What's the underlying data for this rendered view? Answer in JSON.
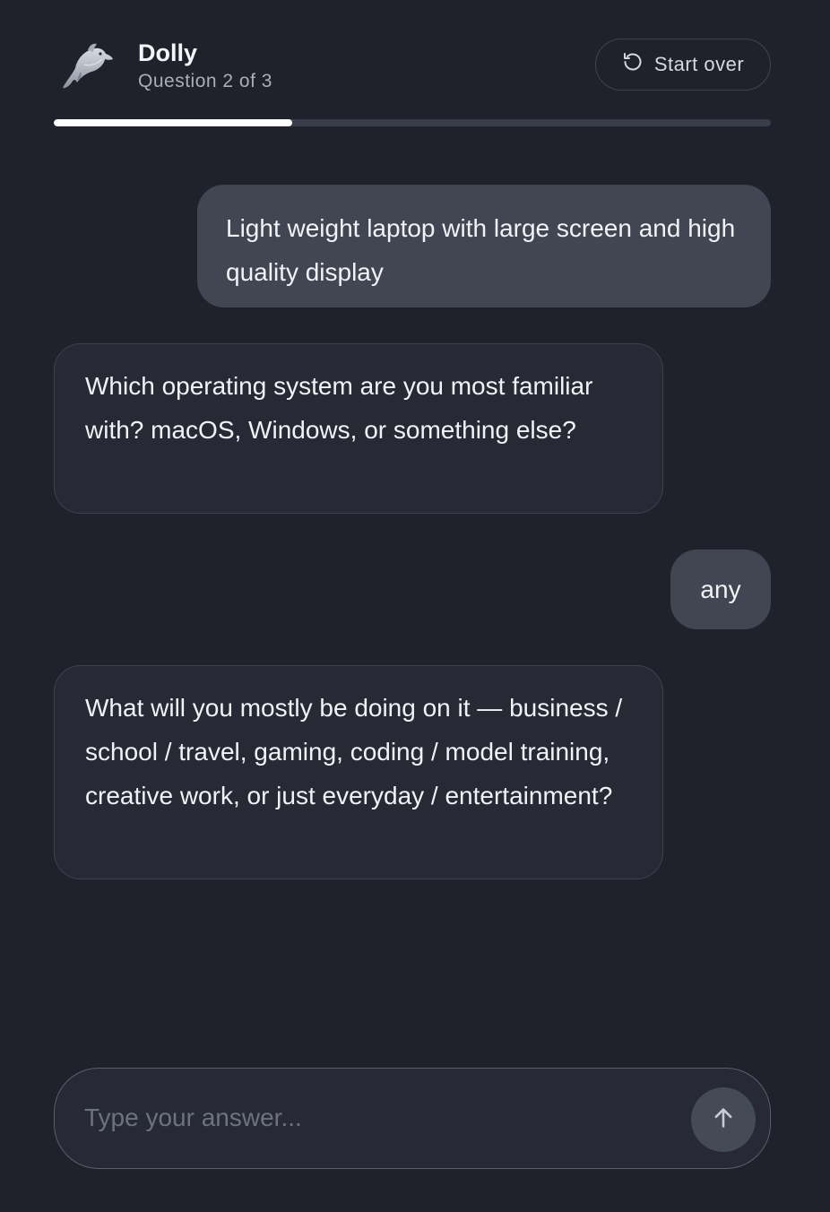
{
  "header": {
    "app_name": "Dolly",
    "subtitle": "Question 2 of 3",
    "avatar_icon": "dolphin-icon",
    "start_over_label": "Start over",
    "start_over_icon": "refresh-icon"
  },
  "progress": {
    "current": 2,
    "total": 3,
    "fraction": 0.333
  },
  "messages": [
    {
      "role": "user",
      "text": "Light weight laptop with large screen and high quality display"
    },
    {
      "role": "assistant",
      "text": "Which operating system are you most familiar with? macOS, Windows, or something else?"
    },
    {
      "role": "user",
      "text": "any"
    },
    {
      "role": "assistant",
      "text": "What will you mostly be doing on it — business / school / travel, gaming, coding / model training, creative work, or just everyday / entertainment?"
    }
  ],
  "composer": {
    "placeholder": "Type your answer...",
    "value": "",
    "send_icon": "arrow-up-icon"
  },
  "colors": {
    "background": "#1f222b",
    "user_bubble": "#424653",
    "assistant_bubble": "#272a35",
    "progress_fill": "#ffffff",
    "progress_track": "#3a3e4a"
  }
}
